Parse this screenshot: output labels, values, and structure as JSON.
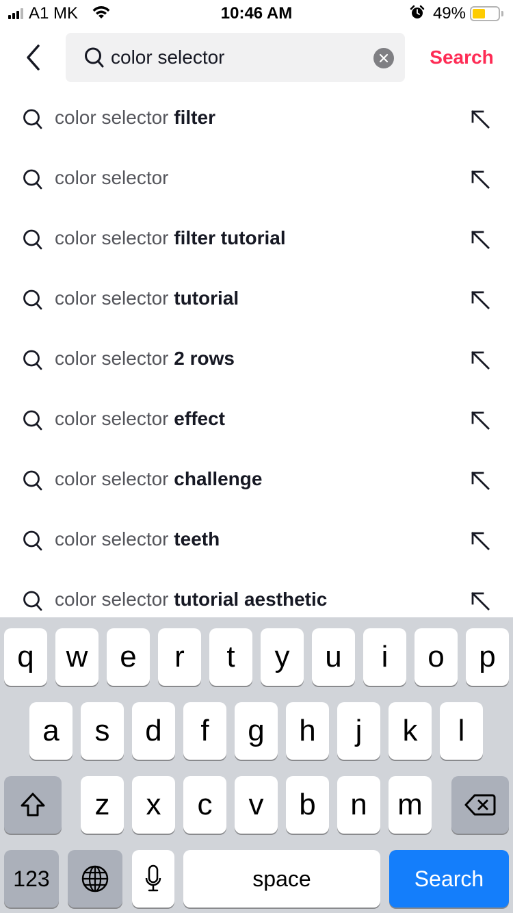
{
  "status_bar": {
    "carrier": "A1 MK",
    "time": "10:46 AM",
    "battery_percent": "49%",
    "battery_level": 0.49,
    "signal_bars": 3,
    "signal_max": 4,
    "icons": [
      "signal-icon",
      "wifi-icon",
      "alarm-icon",
      "battery-icon"
    ]
  },
  "header": {
    "back_icon": "chevron-left-icon",
    "search_icon": "search-icon",
    "search_value": "color selector",
    "clear_icon": "clear-icon",
    "search_button": "Search"
  },
  "colors": {
    "accent": "#fe2c55",
    "keyboard_bg": "#d1d4d9",
    "key_blue": "#147efb",
    "search_box_bg": "#f1f1f2",
    "battery": "#fecc02"
  },
  "suggestions": [
    {
      "base": "color selector",
      "suffix": "filter"
    },
    {
      "base": "color selector",
      "suffix": ""
    },
    {
      "base": "color selector",
      "suffix": "filter tutorial"
    },
    {
      "base": "color selector",
      "suffix": "tutorial"
    },
    {
      "base": "color selector",
      "suffix": "2 rows"
    },
    {
      "base": "color selector",
      "suffix": "effect"
    },
    {
      "base": "color selector",
      "suffix": "challenge"
    },
    {
      "base": "color selector",
      "suffix": "teeth"
    },
    {
      "base": "color selector",
      "suffix": "tutorial aesthetic"
    }
  ],
  "keyboard": {
    "row1": [
      "q",
      "w",
      "e",
      "r",
      "t",
      "y",
      "u",
      "i",
      "o",
      "p"
    ],
    "row2": [
      "a",
      "s",
      "d",
      "f",
      "g",
      "h",
      "j",
      "k",
      "l"
    ],
    "row3": [
      "z",
      "x",
      "c",
      "v",
      "b",
      "n",
      "m"
    ],
    "numbers_label": "123",
    "space_label": "space",
    "return_label": "Search",
    "shift_icon": "shift-icon",
    "delete_icon": "backspace-icon",
    "globe_icon": "globe-icon",
    "mic_icon": "microphone-icon"
  }
}
